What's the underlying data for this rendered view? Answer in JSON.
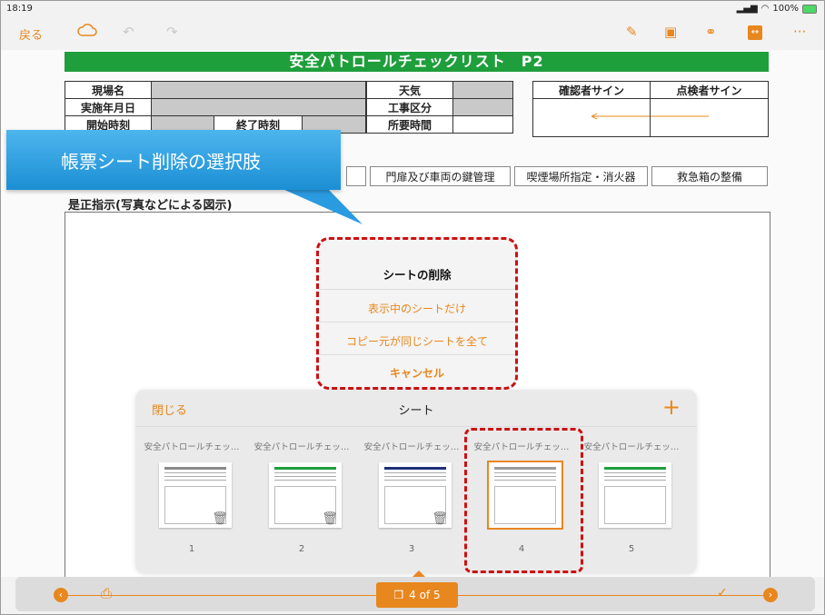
{
  "status": {
    "time": "18:19",
    "battery": "100%"
  },
  "toolbar": {
    "back_label": "戻る",
    "icons": [
      "cloud-icon",
      "undo-icon",
      "redo-icon",
      "pen-icon",
      "image-icon",
      "link-icon",
      "fit-icon",
      "more-icon"
    ]
  },
  "sheet": {
    "title": "安全パトロールチェックリスト　P2",
    "labels": {
      "site_name": "現場名",
      "date": "実施年月日",
      "start_time": "開始時刻",
      "end_time": "終了時刻",
      "weather": "天気",
      "work_type": "工事区分",
      "duration": "所要時間",
      "confirmer_sign": "確認者サイン",
      "inspector_sign": "点検者サイン"
    },
    "check_items": [
      "門扉及び車両の鍵管理",
      "喫煙場所指定・消火器",
      "救急箱の整備"
    ],
    "correction_label": "是正指示(写真などによる図示)"
  },
  "callout": {
    "text": "帳票シート削除の選択肢"
  },
  "action_sheet": {
    "title": "シートの削除",
    "option_current": "表示中のシートだけ",
    "option_all_same": "コピー元が同じシートを全て",
    "cancel": "キャンセル"
  },
  "panel": {
    "close_label": "閉じる",
    "title": "シート",
    "add_label": "+",
    "thumbs": [
      {
        "label": "安全パトロールチェッ…",
        "num": "1",
        "band": "#8a8a8a"
      },
      {
        "label": "安全パトロールチェッ…",
        "num": "2",
        "band": "#1f9e3c"
      },
      {
        "label": "安全パトロールチェッ…",
        "num": "3",
        "band": "#1f2f7a"
      },
      {
        "label": "安全パトロールチェッ…",
        "num": "4",
        "band": "#9a9a9a"
      },
      {
        "label": "安全パトロールチェッ…",
        "num": "5",
        "band": "#1f9e3c"
      }
    ],
    "selected_index": 3
  },
  "bottom": {
    "pager_label": "4 of 5"
  },
  "colors": {
    "accent": "#e8871e",
    "highlight": "#cc1111",
    "title_green": "#1f9e3c",
    "callout_blue": "#2a9be0"
  }
}
